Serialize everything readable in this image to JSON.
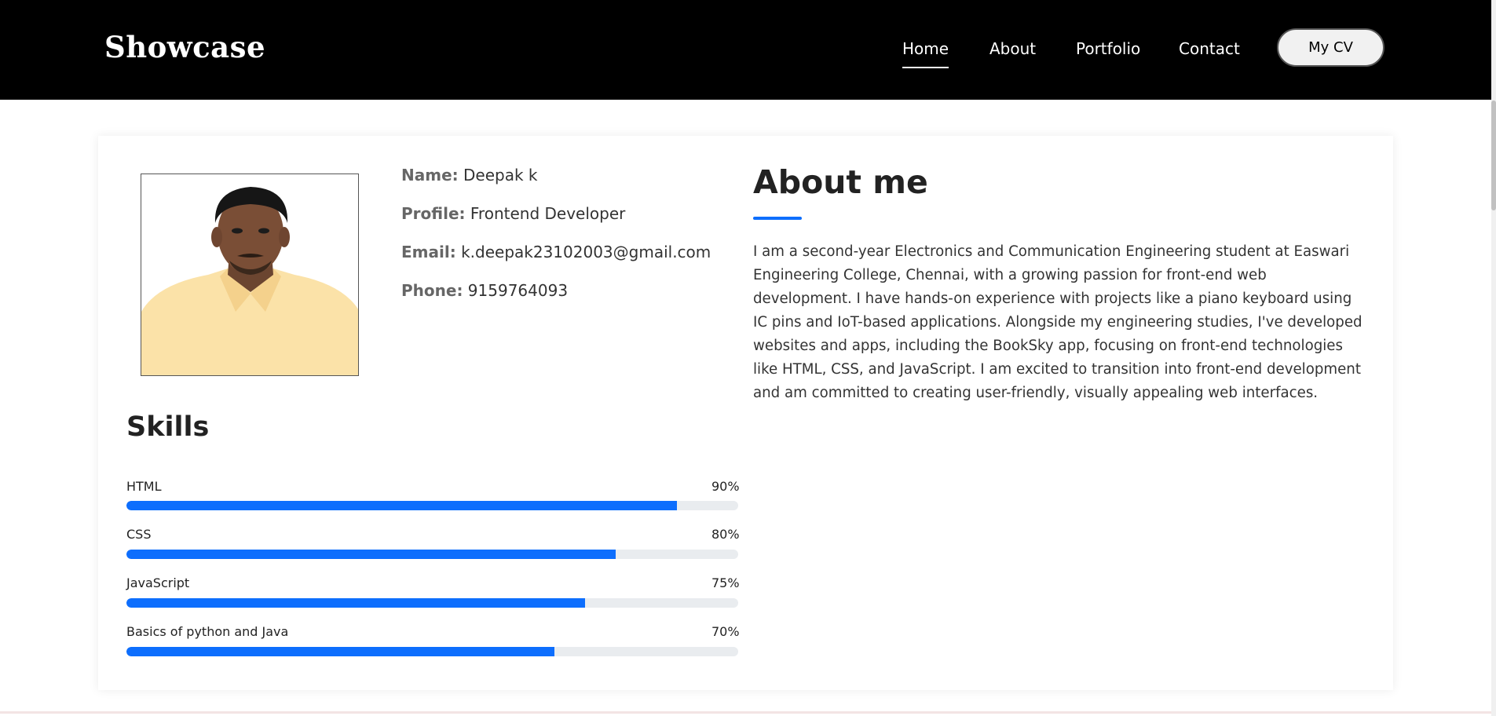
{
  "header": {
    "logo": "Showcase",
    "nav": [
      {
        "label": "Home",
        "active": true
      },
      {
        "label": "About",
        "active": false
      },
      {
        "label": "Portfolio",
        "active": false
      },
      {
        "label": "Contact",
        "active": false
      }
    ],
    "cv_button": "My CV"
  },
  "profile": {
    "name_label": "Name:",
    "name_value": "Deepak k",
    "profile_label": "Profile:",
    "profile_value": "Frontend Developer",
    "email_label": "Email:",
    "email_value": "k.deepak23102003@gmail.com",
    "phone_label": "Phone:",
    "phone_value": "9159764093"
  },
  "about": {
    "title": "About me",
    "text": "I am a second-year Electronics and Communication Engineering student at Easwari Engineering College, Chennai, with a growing passion for front-end web development. I have hands-on experience with projects like a piano keyboard using IC pins and IoT-based applications. Alongside my engineering studies, I've developed websites and apps, including the BookSky app, focusing on front-end technologies like HTML, CSS, and JavaScript. I am excited to transition into front-end development and am committed to creating user-friendly, visually appealing web interfaces."
  },
  "skills": {
    "title": "Skills",
    "items": [
      {
        "name": "HTML",
        "percent_label": "90%",
        "level": 0.9
      },
      {
        "name": "CSS",
        "percent_label": "80%",
        "level": 0.8
      },
      {
        "name": "JavaScript",
        "percent_label": "75%",
        "level": 0.75
      },
      {
        "name": "Basics of python and Java",
        "percent_label": "70%",
        "level": 0.7
      }
    ]
  },
  "colors": {
    "header_bg": "#000000",
    "accent": "#0d6efd",
    "track": "#e9ecef"
  }
}
